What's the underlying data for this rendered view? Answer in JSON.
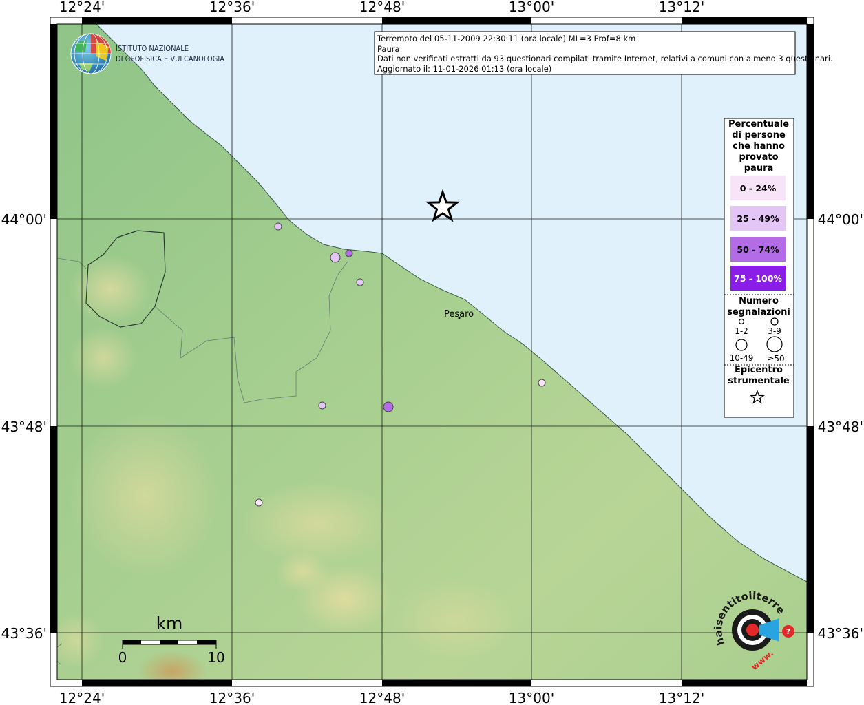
{
  "map": {
    "lon_ticks": [
      "12°24'",
      "12°36'",
      "12°48'",
      "13°00'",
      "13°12'"
    ],
    "lat_ticks": [
      "44°00'",
      "43°48'",
      "43°36'"
    ],
    "place_label": "Pesaro",
    "scale_title": "km",
    "scale_start": "0",
    "scale_end": "10"
  },
  "info": {
    "line1": "Terremoto del 05-11-2009 22:30:11 (ora locale) ML=3 Prof=8 km",
    "line2": "Paura",
    "line3": "Dati non verificati estratti da 93 questionari compilati tramite Internet, relativi a comuni con almeno 3 questionari.",
    "line4": "Aggiornato il: 11-01-2026 01:13 (ora locale)"
  },
  "logo": {
    "line1": "ISTITUTO NAZIONALE",
    "line2": "DI GEOFISICA E VULCANOLOGIA"
  },
  "legend": {
    "title_lines": [
      "Percentuale",
      "di persone",
      "che hanno",
      "provato",
      "paura"
    ],
    "ranges": [
      {
        "label": "0 - 24%",
        "color": "#f8e4f8",
        "text_color": "#000000"
      },
      {
        "label": "25 - 49%",
        "color": "#e3c6f5",
        "text_color": "#000000"
      },
      {
        "label": "50 - 74%",
        "color": "#b46ce6",
        "text_color": "#000000"
      },
      {
        "label": "75 - 100%",
        "color": "#8a1ee8",
        "text_color": "#ffffff"
      }
    ],
    "count_title_lines": [
      "Numero",
      "segnalazioni"
    ],
    "count_labels": [
      "1-2",
      "3-9",
      "10-49",
      "≥50"
    ],
    "epicenter_title_lines": [
      "Epicentro",
      "strumentale"
    ]
  },
  "badge": {
    "main_text": "haisentitoilterremoto.it",
    "www_text": "www."
  },
  "colors": {
    "sea": "#e0f1fc",
    "land": "#9ccb8c",
    "epicenter": "#000000"
  }
}
